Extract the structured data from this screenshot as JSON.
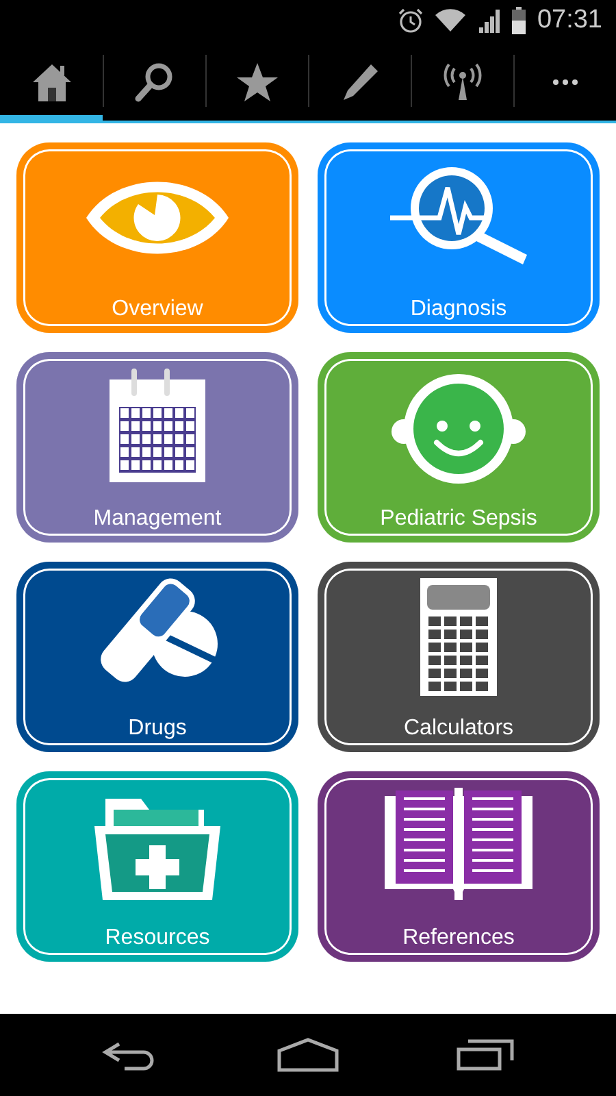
{
  "status_bar": {
    "time": "07:31"
  },
  "tabs": [
    {
      "kind": "home",
      "selected": true
    },
    {
      "kind": "search",
      "selected": false
    },
    {
      "kind": "star",
      "selected": false
    },
    {
      "kind": "pencil",
      "selected": false
    },
    {
      "kind": "antenna",
      "selected": false
    },
    {
      "kind": "more",
      "selected": false
    }
  ],
  "tiles": [
    {
      "label": "Overview",
      "kind": "eye",
      "color": "#ff8c00"
    },
    {
      "label": "Diagnosis",
      "kind": "diagnosis",
      "color": "#0a8cff"
    },
    {
      "label": "Management",
      "kind": "calendar",
      "color": "#7b74ad"
    },
    {
      "label": "Pediatric Sepsis",
      "kind": "face",
      "color": "#5fae3a"
    },
    {
      "label": "Drugs",
      "kind": "pills",
      "color": "#004a8f"
    },
    {
      "label": "Calculators",
      "kind": "calculator",
      "color": "#4a4a4a"
    },
    {
      "label": "Resources",
      "kind": "folder",
      "color": "#00aba9"
    },
    {
      "label": "References",
      "kind": "book",
      "color": "#6e357e"
    }
  ]
}
